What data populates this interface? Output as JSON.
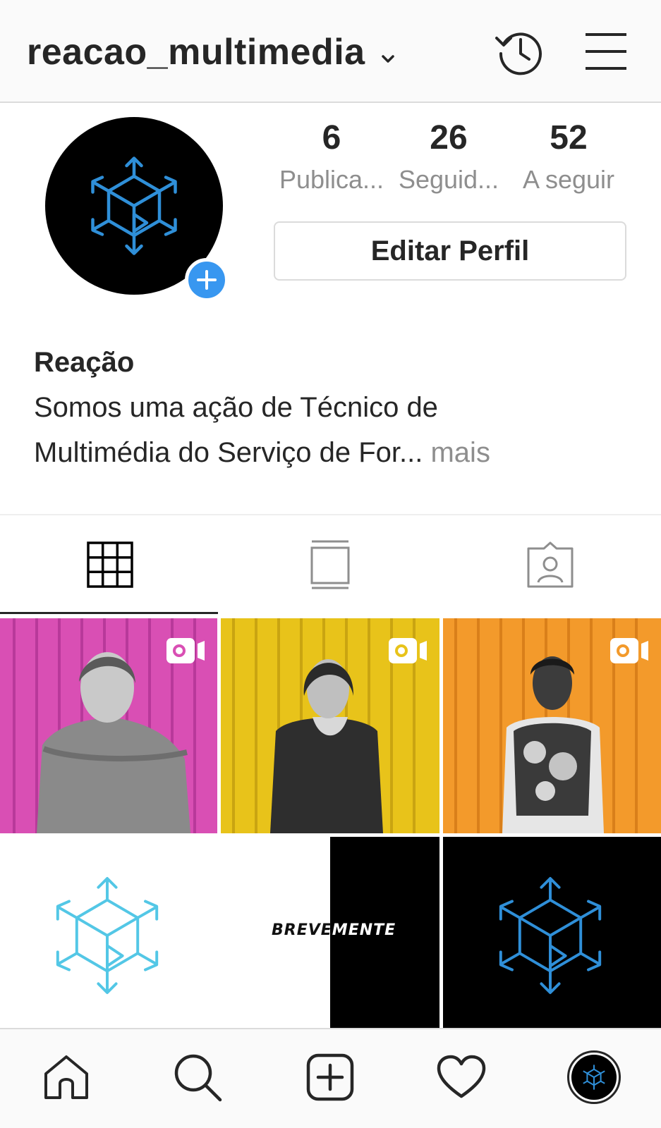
{
  "header": {
    "username": "reacao_multimedia",
    "icons": [
      "chevron-down-icon",
      "history-icon",
      "menu-icon"
    ]
  },
  "profile": {
    "stats": [
      {
        "count": "6",
        "label": "Publica..."
      },
      {
        "count": "26",
        "label": "Seguid..."
      },
      {
        "count": "52",
        "label": "A seguir"
      }
    ],
    "edit_button": "Editar Perfil",
    "bio_name": "Reação",
    "bio_line1": "Somos uma ação de Técnico de",
    "bio_line2": "Multimédia do Serviço de For...",
    "bio_more": "mais"
  },
  "tabs": [
    "grid-icon",
    "igtv-icon",
    "tagged-icon"
  ],
  "posts": [
    {
      "type": "video",
      "bg": "#d94fb4",
      "subject": "woman-portrait"
    },
    {
      "type": "video",
      "bg": "#e8c31a",
      "subject": "woman-portrait"
    },
    {
      "type": "video",
      "bg": "#f39a2b",
      "subject": "woman-portrait"
    },
    {
      "type": "image",
      "bg": "#ffffff",
      "subject": "logo-cyan"
    },
    {
      "type": "image",
      "bg": "#ffffff",
      "subject": "teaser",
      "text_left": "BREVE",
      "text_right": "MENTE"
    },
    {
      "type": "image",
      "bg": "#000000",
      "subject": "logo-blue"
    }
  ],
  "bottom_nav": [
    "home-icon",
    "search-icon",
    "add-post-icon",
    "heart-icon",
    "profile-avatar"
  ],
  "colors": {
    "accent_blue": "#3897f0",
    "logo_blue": "#2f8fd8",
    "logo_cyan": "#53c7e6",
    "muted": "#8e8e8e"
  }
}
